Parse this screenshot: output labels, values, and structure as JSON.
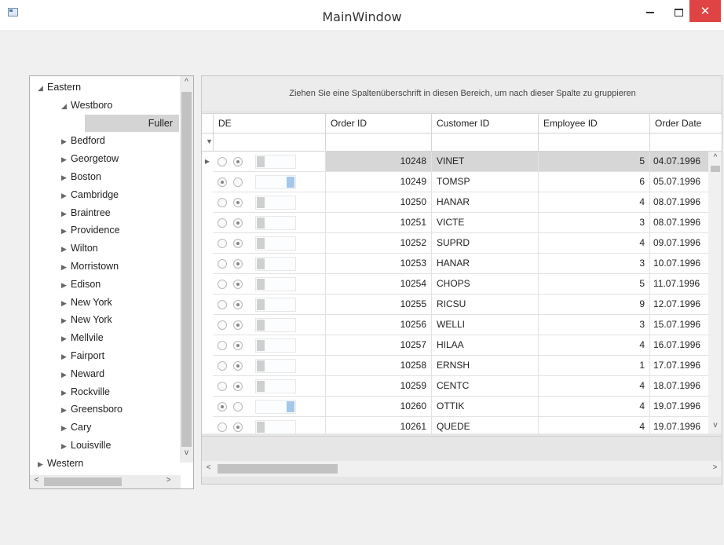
{
  "window": {
    "title": "MainWindow",
    "close_glyph": "✕"
  },
  "tree": {
    "items": [
      {
        "label": "Eastern",
        "level": 0,
        "expanded": true
      },
      {
        "label": "Westboro",
        "level": 1,
        "expanded": true
      },
      {
        "label": "Fuller",
        "level": 2,
        "selected": true
      },
      {
        "label": "Bedford",
        "level": 1
      },
      {
        "label": "Georgetow",
        "level": 1
      },
      {
        "label": "Boston",
        "level": 1
      },
      {
        "label": "Cambridge",
        "level": 1
      },
      {
        "label": "Braintree",
        "level": 1
      },
      {
        "label": "Providence",
        "level": 1
      },
      {
        "label": "Wilton",
        "level": 1
      },
      {
        "label": "Morristown",
        "level": 1
      },
      {
        "label": "Edison",
        "level": 1
      },
      {
        "label": "New York",
        "level": 1
      },
      {
        "label": "New York",
        "level": 1
      },
      {
        "label": "Mellvile",
        "level": 1
      },
      {
        "label": "Fairport",
        "level": 1
      },
      {
        "label": "Neward",
        "level": 1
      },
      {
        "label": "Rockville",
        "level": 1
      },
      {
        "label": "Greensboro",
        "level": 1
      },
      {
        "label": "Cary",
        "level": 1
      },
      {
        "label": "Louisville",
        "level": 1
      },
      {
        "label": "Western",
        "level": 0
      }
    ]
  },
  "grid": {
    "group_panel_text": "Ziehen Sie eine Spaltenüberschrift in diesen Bereich, um nach dieser Spalte zu gruppieren",
    "columns": [
      "DE",
      "Order ID",
      "Customer ID",
      "Employee ID",
      "Order Date"
    ],
    "rows": [
      {
        "order_id": "10248",
        "customer_id": "VINET",
        "employee_id": "5",
        "order_date": "04.07.1996",
        "de": false,
        "current": true
      },
      {
        "order_id": "10249",
        "customer_id": "TOMSP",
        "employee_id": "6",
        "order_date": "05.07.1996",
        "de": true
      },
      {
        "order_id": "10250",
        "customer_id": "HANAR",
        "employee_id": "4",
        "order_date": "08.07.1996",
        "de": false
      },
      {
        "order_id": "10251",
        "customer_id": "VICTE",
        "employee_id": "3",
        "order_date": "08.07.1996",
        "de": false
      },
      {
        "order_id": "10252",
        "customer_id": "SUPRD",
        "employee_id": "4",
        "order_date": "09.07.1996",
        "de": false
      },
      {
        "order_id": "10253",
        "customer_id": "HANAR",
        "employee_id": "3",
        "order_date": "10.07.1996",
        "de": false
      },
      {
        "order_id": "10254",
        "customer_id": "CHOPS",
        "employee_id": "5",
        "order_date": "11.07.1996",
        "de": false
      },
      {
        "order_id": "10255",
        "customer_id": "RICSU",
        "employee_id": "9",
        "order_date": "12.07.1996",
        "de": false
      },
      {
        "order_id": "10256",
        "customer_id": "WELLI",
        "employee_id": "3",
        "order_date": "15.07.1996",
        "de": false
      },
      {
        "order_id": "10257",
        "customer_id": "HILAA",
        "employee_id": "4",
        "order_date": "16.07.1996",
        "de": false
      },
      {
        "order_id": "10258",
        "customer_id": "ERNSH",
        "employee_id": "1",
        "order_date": "17.07.1996",
        "de": false
      },
      {
        "order_id": "10259",
        "customer_id": "CENTC",
        "employee_id": "4",
        "order_date": "18.07.1996",
        "de": false
      },
      {
        "order_id": "10260",
        "customer_id": "OTTIK",
        "employee_id": "4",
        "order_date": "19.07.1996",
        "de": true
      },
      {
        "order_id": "10261",
        "customer_id": "QUEDE",
        "employee_id": "4",
        "order_date": "19.07.1996",
        "de": false
      }
    ]
  }
}
